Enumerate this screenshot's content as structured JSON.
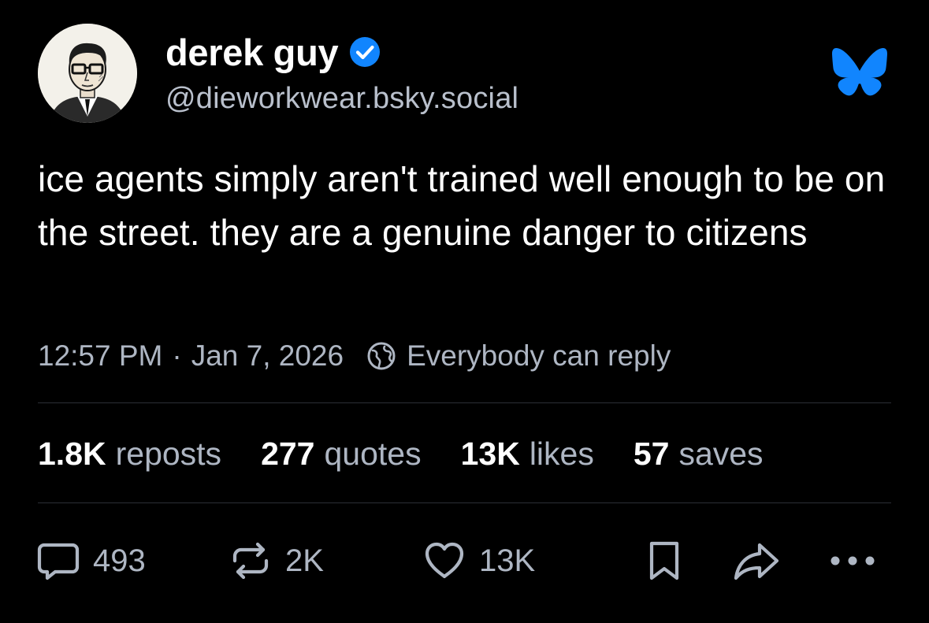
{
  "author": {
    "display_name": "derek guy",
    "handle": "@dieworkwear.bsky.social",
    "verified": true,
    "avatar_icon": "illustrated-portrait-avatar"
  },
  "app": {
    "logo_icon": "bluesky-butterfly-icon",
    "accent_color": "#1185fe"
  },
  "post": {
    "text": "ice agents simply aren't trained well enough to be on the street. they are a genuine danger to citizens",
    "time": "12:57 PM",
    "separator": "·",
    "date": "Jan 7, 2026",
    "reply_setting_icon": "globe-icon",
    "reply_setting": "Everybody can reply"
  },
  "stats": [
    {
      "value": "1.8K",
      "label": "reposts"
    },
    {
      "value": "277",
      "label": "quotes"
    },
    {
      "value": "13K",
      "label": "likes"
    },
    {
      "value": "57",
      "label": "saves"
    }
  ],
  "actions": {
    "reply": {
      "icon": "comment-bubble-icon",
      "count": "493"
    },
    "repost": {
      "icon": "repost-arrows-icon",
      "count": "2K"
    },
    "like": {
      "icon": "heart-icon",
      "count": "13K"
    },
    "save": {
      "icon": "bookmark-icon"
    },
    "share": {
      "icon": "share-arrow-icon"
    },
    "more": {
      "icon": "ellipsis-icon"
    }
  },
  "colors": {
    "background": "#000000",
    "primary_text": "#ffffff",
    "secondary_text": "#aeb6c3",
    "divider": "#2b2f36",
    "verified_badge": "#1185fe"
  }
}
